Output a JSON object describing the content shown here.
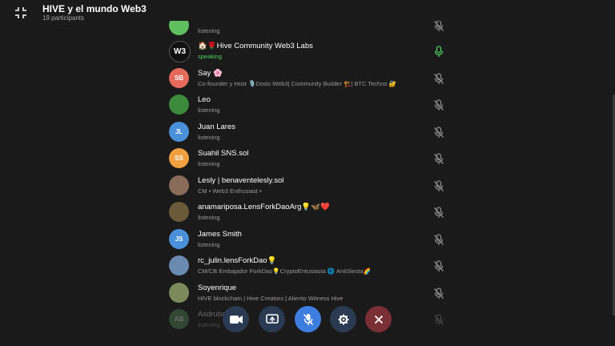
{
  "header": {
    "title": "HIVE y el mundo Web3",
    "subtitle": "19 participants"
  },
  "participants": [
    {
      "name": "",
      "status": "listening",
      "avatar_initials": "",
      "avatar_color": "#5fbf5f",
      "mic": "muted"
    },
    {
      "name": "🏠🌹Hive Community Web3 Labs",
      "status": "speaking",
      "avatar_initials": "W3",
      "avatar_color": "#111111",
      "mic": "active"
    },
    {
      "name": "Say 🌸",
      "status": "Co-founder y Host 🎙️Dosis Web3| Community Builder 🏗️| BTC Techno 🔐",
      "avatar_initials": "SB",
      "avatar_color": "#e56a5b",
      "mic": "muted"
    },
    {
      "name": "Leo",
      "status": "listening",
      "avatar_initials": "",
      "avatar_color": "#3c8a3c",
      "mic": "muted"
    },
    {
      "name": "Juan Lares",
      "status": "listening",
      "avatar_initials": "JL",
      "avatar_color": "#4a90d9",
      "mic": "muted"
    },
    {
      "name": "Suahil SNS.sol",
      "status": "listening",
      "avatar_initials": "SS",
      "avatar_color": "#f0a040",
      "mic": "muted"
    },
    {
      "name": "Lesly | benaventelesly.sol",
      "status": "CM • Web3 Enthusiast •",
      "avatar_initials": "",
      "avatar_color": "#8a6a58",
      "mic": "muted"
    },
    {
      "name": "anamariposa.LensForkDaoArg💡🦋❤️",
      "status": "listening",
      "avatar_initials": "",
      "avatar_color": "#6b5a3a",
      "mic": "muted"
    },
    {
      "name": "James Smith",
      "status": "listening",
      "avatar_initials": "JS",
      "avatar_color": "#4a90d9",
      "mic": "muted"
    },
    {
      "name": "rc_julin.lensForkDao💡",
      "status": "CM/CB Embajador ForkDao💡CryptoEntusiasta 🌐 AntiSiesta🌈",
      "avatar_initials": "",
      "avatar_color": "#6a8ab0",
      "mic": "muted"
    },
    {
      "name": "Soyenrique",
      "status": "HIVE blockchain | Hive Creators | Aliento Witness Hive",
      "avatar_initials": "",
      "avatar_color": "#7a8a5a",
      "mic": "muted"
    },
    {
      "name": "Asdruba",
      "status": "listening",
      "avatar_initials": "AB",
      "avatar_color": "#5f9a5f",
      "mic": "muted"
    }
  ],
  "controls": [
    {
      "name": "video-button",
      "icon": "video-camera-icon",
      "bg": "#2a3a52"
    },
    {
      "name": "share-screen-button",
      "icon": "screen-share-icon",
      "bg": "#2a3a52"
    },
    {
      "name": "mute-button",
      "icon": "microphone-off-icon",
      "bg": "#3d7de0"
    },
    {
      "name": "settings-button",
      "icon": "gear-icon",
      "bg": "#2a3a52"
    },
    {
      "name": "leave-button",
      "icon": "close-icon",
      "bg": "#7a2f37"
    }
  ],
  "colors": {
    "background": "#1a1a1a",
    "speaking": "#4fcf5f",
    "muted_icon": "#8a8a8a",
    "accent": "#3d7de0",
    "danger": "#7a2f37"
  }
}
